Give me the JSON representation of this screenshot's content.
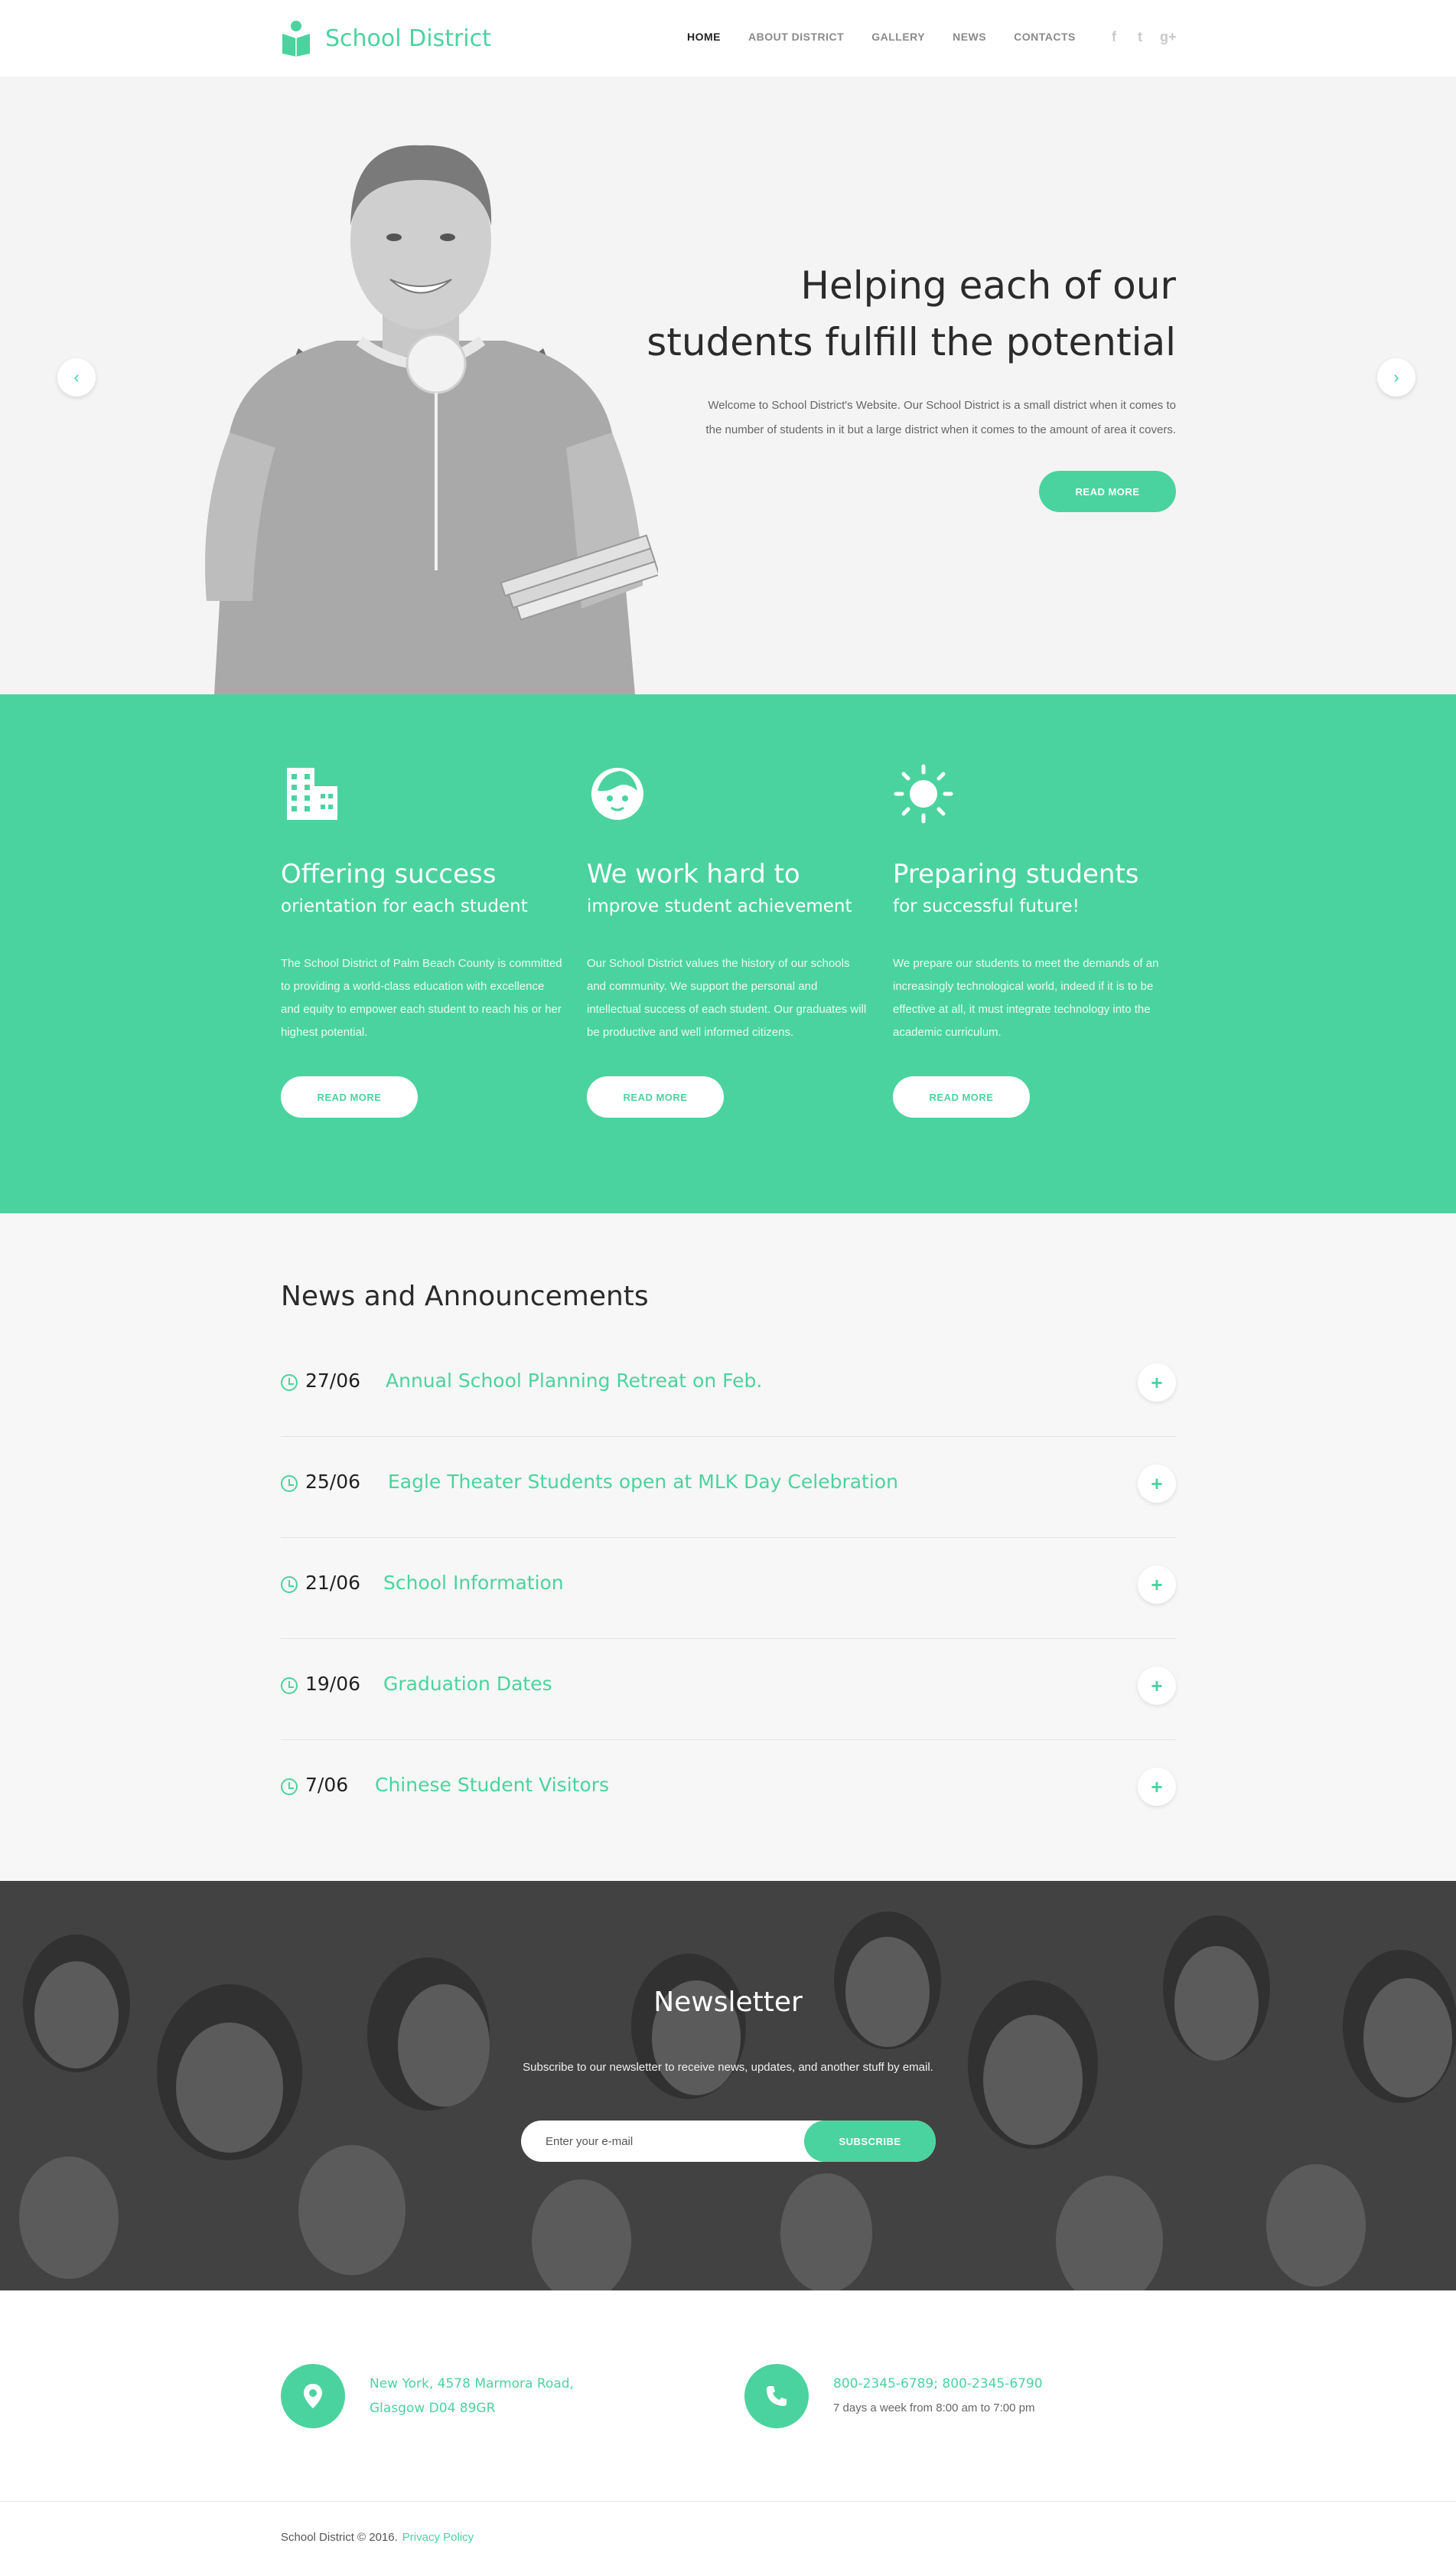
{
  "header": {
    "logo_text": "School District",
    "nav": [
      "HOME",
      "ABOUT DISTRICT",
      "GALLERY",
      "NEWS",
      "CONTACTS"
    ],
    "active_nav": "HOME",
    "social": [
      {
        "icon": "facebook-icon",
        "glyph": "f"
      },
      {
        "icon": "twitter-icon",
        "glyph": "t"
      },
      {
        "icon": "google-plus-icon",
        "glyph": "g+"
      }
    ]
  },
  "hero": {
    "title_line1": "Helping each of our",
    "title_line2": "students fulfill the potential",
    "text_line1": "Welcome to School District's Website. Our School District is a small district when it comes to",
    "text_line2": "the number of students in it but a large district when it comes to the amount of area it covers.",
    "button": "READ MORE",
    "prev_arrow": "‹",
    "next_arrow": "›"
  },
  "features": [
    {
      "icon": "building-icon",
      "title": "Offering success",
      "subtitle": "orientation for each student",
      "text": "The School District of Palm Beach County is committed to providing a world-class education with excellence and equity to empower each student to reach his or her highest potential.",
      "button": "READ MORE"
    },
    {
      "icon": "face-icon",
      "title": "We work hard to",
      "subtitle": "improve student achievement",
      "text": "Our School District values the history of our schools and community. We support the personal and intellectual success of each student. Our graduates will be productive and well informed citizens.",
      "button": "READ MORE"
    },
    {
      "icon": "sun-icon",
      "title": "Preparing students",
      "subtitle": "for successful future!",
      "text": "We prepare our students to meet the demands of an increasingly technological world, indeed if it is to be effective at all, it must integrate technology into the academic curriculum.",
      "button": "READ MORE"
    }
  ],
  "news": {
    "title": "News and Announcements",
    "items": [
      {
        "date": "27/06",
        "headline": "Annual School Planning Retreat on Feb."
      },
      {
        "date": "25/06",
        "headline": "Eagle Theater Students open at MLK Day Celebration"
      },
      {
        "date": "21/06",
        "headline": "School Information"
      },
      {
        "date": "19/06",
        "headline": "Graduation Dates"
      },
      {
        "date": "7/06",
        "headline": "Chinese Student Visitors"
      }
    ],
    "expand_glyph": "+"
  },
  "newsletter": {
    "title": "Newsletter",
    "text": "Subscribe to our newsletter to receive news, updates, and another stuff by email.",
    "placeholder": "Enter your e-mail",
    "button": "SUBSCRIBE"
  },
  "contacts": {
    "address_line1": "New York, 4578 Marmora Road,",
    "address_line2": "Glasgow D04 89GR",
    "phone": "800-2345-6789; 800-2345-6790",
    "hours": "7 days a week from 8:00 am to 7:00 pm"
  },
  "footer": {
    "copyright": "School District © 2016.",
    "privacy": "Privacy Policy"
  },
  "colors": {
    "accent": "#4bd39f",
    "hero_bg": "#f4f4f4",
    "news_bg": "#f7f7f7",
    "newsletter_bg": "#4a4a4a"
  }
}
